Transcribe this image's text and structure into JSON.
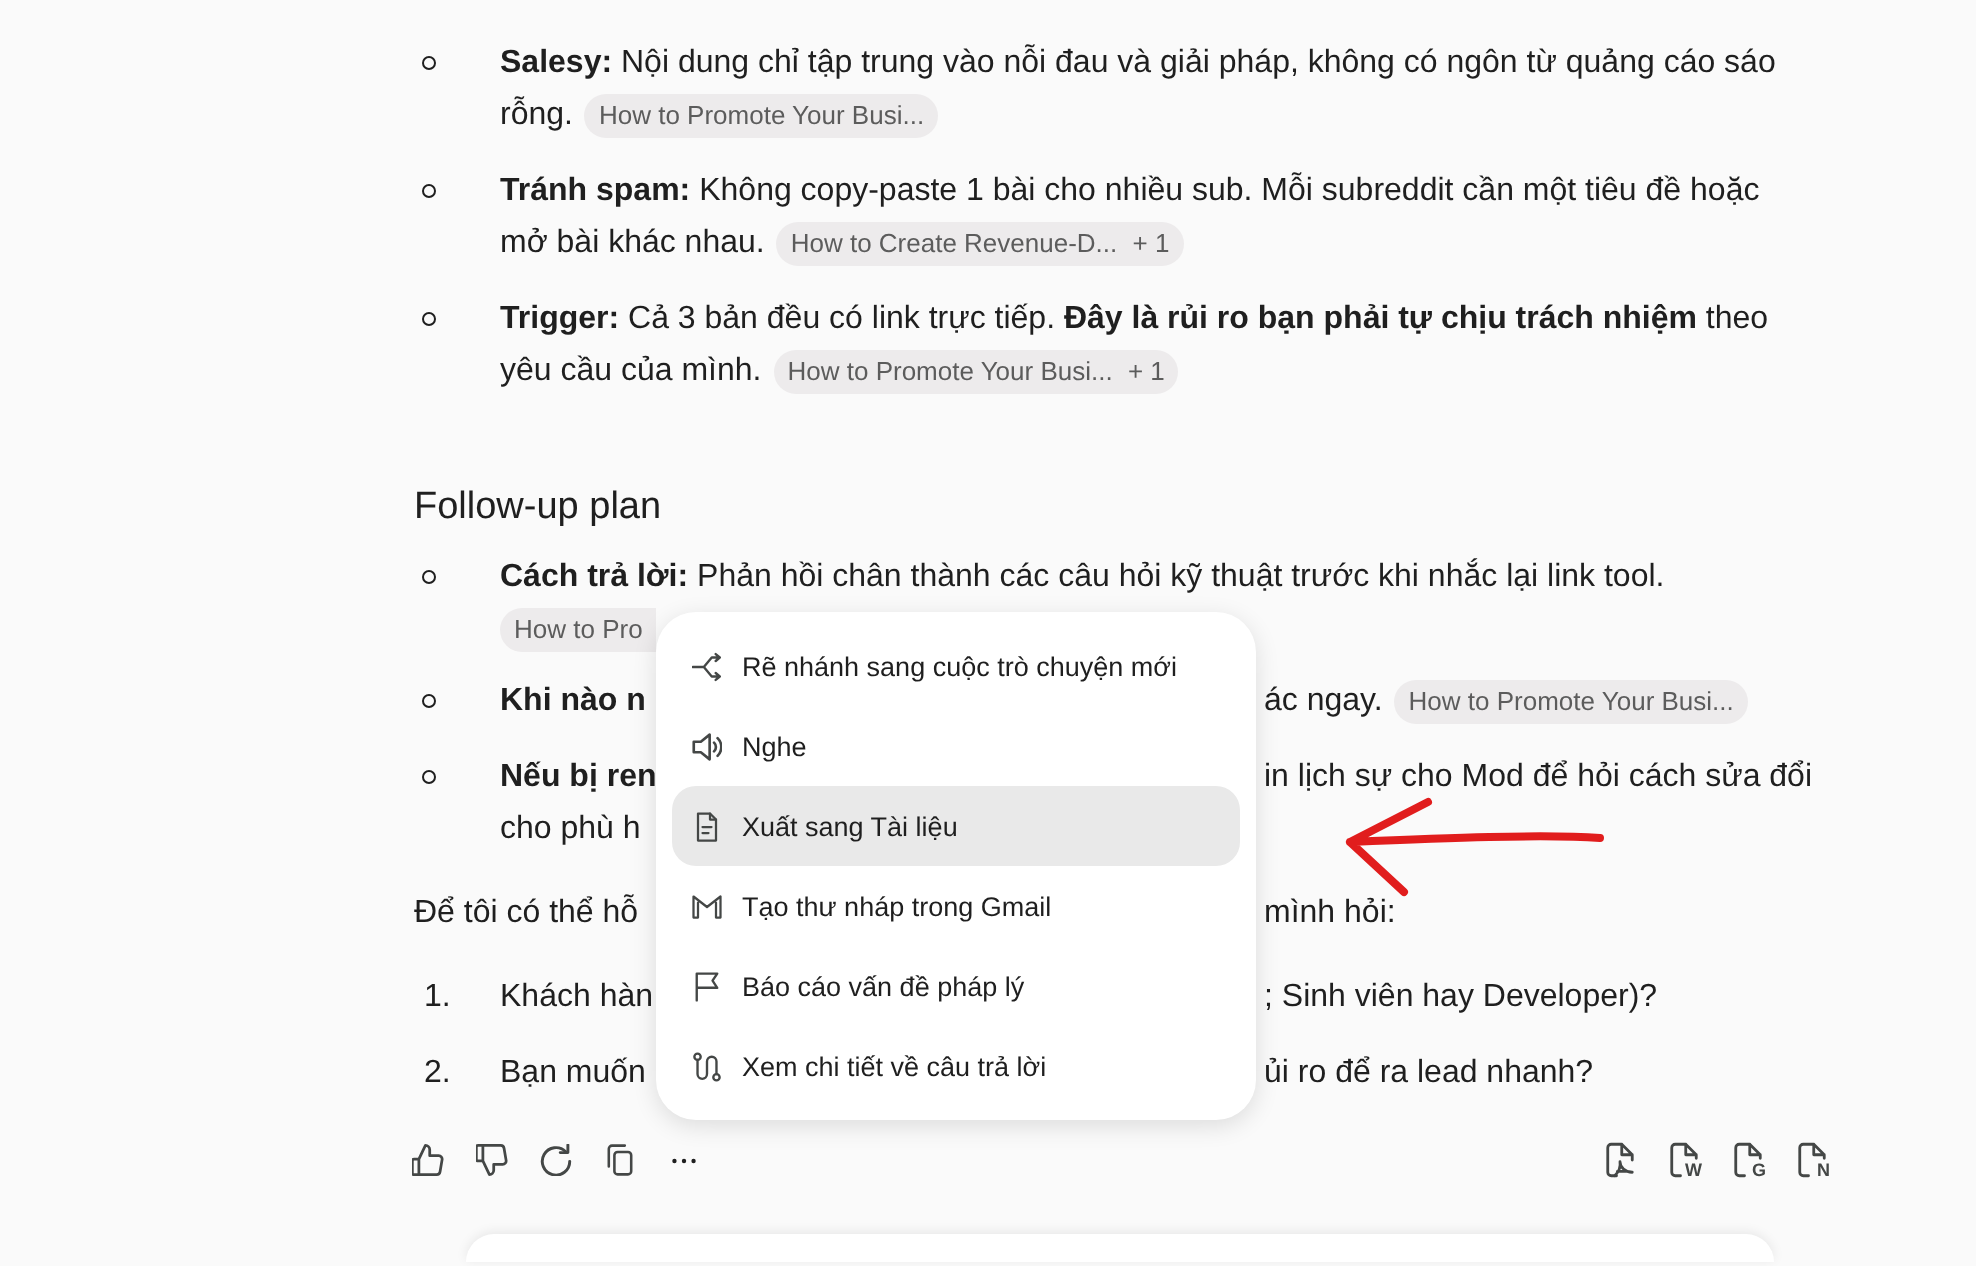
{
  "tips": [
    {
      "label": "Salesy:",
      "lines": [
        "Nội dung chỉ tập trung vào nỗi đau và giải pháp, không có ngôn từ quảng cáo sáo",
        "rỗng."
      ],
      "source": {
        "title": "How to Promote Your Busi..."
      }
    },
    {
      "label": "Tránh spam:",
      "lines": [
        "Không copy-paste 1 bài cho nhiều sub. Mỗi subreddit cần một tiêu đề hoặc",
        "mở bài khác nhau."
      ],
      "source": {
        "title": "How to Create Revenue-D...",
        "more": "+ 1"
      }
    },
    {
      "label": "Trigger:",
      "lines": [
        "Cả 3 bản đều có link trực tiếp. **Đây là rủi ro bạn phải tự chịu trách nhiệm** theo",
        "yêu cầu của mình."
      ],
      "source": {
        "title": "How to Promote Your Busi...",
        "more": "+ 1"
      }
    }
  ],
  "follow_up": {
    "heading": "Follow-up plan",
    "items": [
      {
        "lines": [
          {
            "kind": "full",
            "label": "Cách trả lời:",
            "text": "Phản hồi chân thành các câu hỏi kỹ thuật trước khi nhắc lại link tool."
          },
          {
            "kind": "split",
            "source": {
              "title": "How to Pro"
            }
          }
        ]
      },
      {
        "lines": [
          {
            "kind": "split",
            "label": "Khi nào n",
            "right": "ác ngay.",
            "right_source": {
              "title": "How to Promote Your Busi..."
            }
          }
        ]
      },
      {
        "lines": [
          {
            "kind": "split",
            "label": "Nếu bị ren",
            "right": "in lịch sự cho Mod để hỏi cách sửa đổi"
          },
          {
            "kind": "split",
            "text": "cho phù h"
          }
        ]
      }
    ]
  },
  "closing": {
    "left": "Để tôi có thể hỗ",
    "right": "mình hỏi:"
  },
  "questions": [
    {
      "number": "1.",
      "left": "Khách hàn",
      "right": "; Sinh viên hay Developer)?"
    },
    {
      "number": "2.",
      "left": "Bạn muốn",
      "right": "ủi ro để ra lead nhanh?"
    }
  ],
  "export_buttons": [
    {
      "kind": "pdf"
    },
    {
      "kind": "letter",
      "letter": "W"
    },
    {
      "kind": "letter",
      "letter": "G"
    },
    {
      "kind": "letter",
      "letter": "N"
    }
  ],
  "menu": {
    "items": [
      {
        "label": "Rẽ nhánh sang cuộc trò chuyện mới",
        "selected": false
      },
      {
        "label": "Nghe",
        "selected": false
      },
      {
        "label": "Xuất sang Tài liệu",
        "selected": true
      },
      {
        "label": "Tạo thư nháp trong Gmail",
        "selected": false
      },
      {
        "label": "Báo cáo vấn đề pháp lý",
        "selected": false
      },
      {
        "label": "Xem chi tiết về câu trả lời",
        "selected": false
      }
    ]
  }
}
